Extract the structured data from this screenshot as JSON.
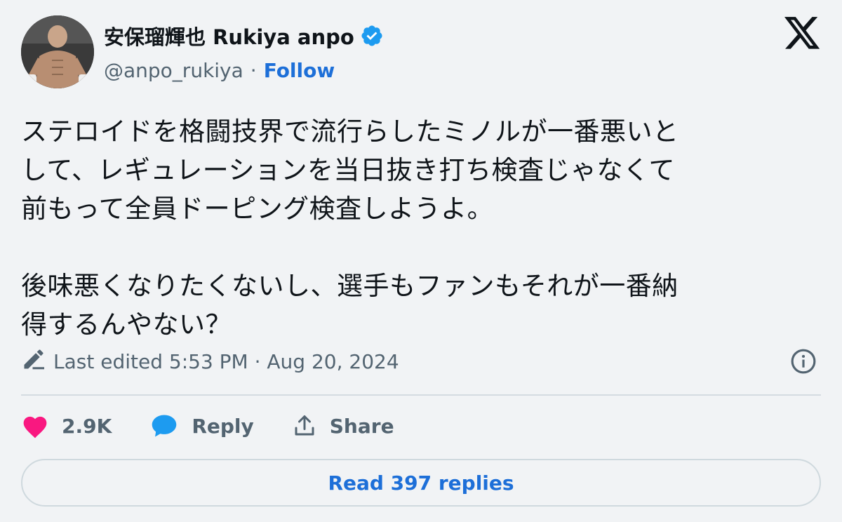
{
  "author": {
    "display_name": "安保瑠輝也 Rukiya anpo",
    "handle": "@anpo_rukiya",
    "separator": "·",
    "follow_label": "Follow",
    "verified_color": "#1d9bf0"
  },
  "tweet": {
    "lines": [
      "ステロイドを格闘技界で流行らしたミノルが一番悪いと",
      "して、レギュレーションを当日抜き打ち検査じゃなくて",
      "前もって全員ドーピング検査しようよ。",
      "後味悪くなりたくないし、選手もファンもそれが一番納",
      "得するんやない？"
    ]
  },
  "edited": {
    "text": "Last edited 5:53 PM · Aug 20, 2024",
    "icon": "pencil-icon"
  },
  "actions": {
    "like_count": "2.9K",
    "reply_label": "Reply",
    "share_label": "Share"
  },
  "read_replies_label": "Read 397 replies",
  "colors": {
    "background": "#f1f3f5",
    "like": "#f91880",
    "reply": "#1d9bf0",
    "link": "#1d6fd8",
    "muted": "#536471"
  }
}
